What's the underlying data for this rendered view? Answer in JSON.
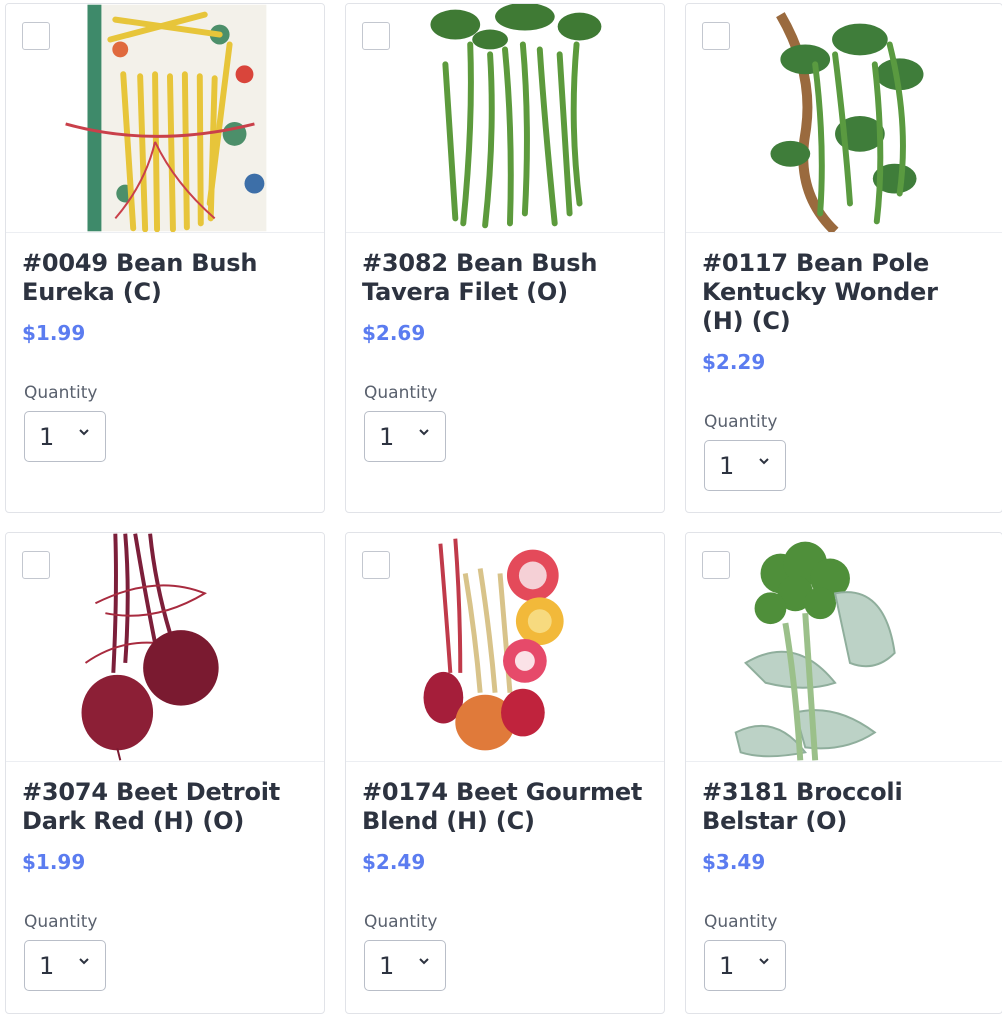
{
  "products": [
    {
      "title": "#0049 Bean Bush Eureka (C)",
      "price": "$1.99",
      "qty_label": "Quantity",
      "qty_value": "1",
      "image_icon": "yellow-bush-beans-illustration"
    },
    {
      "title": "#3082 Bean Bush Tavera Filet (O)",
      "price": "$2.69",
      "qty_label": "Quantity",
      "qty_value": "1",
      "image_icon": "green-filet-beans-illustration"
    },
    {
      "title": "#0117 Bean Pole Kentucky Wonder (H) (C)",
      "price": "$2.29",
      "qty_label": "Quantity",
      "qty_value": "1",
      "image_icon": "pole-beans-illustration"
    },
    {
      "title": "#3074 Beet Detroit Dark Red (H) (O)",
      "price": "$1.99",
      "qty_label": "Quantity",
      "qty_value": "1",
      "image_icon": "red-beets-illustration"
    },
    {
      "title": "#0174 Beet Gourmet Blend (H) (C)",
      "price": "$2.49",
      "qty_label": "Quantity",
      "qty_value": "1",
      "image_icon": "gourmet-beets-illustration"
    },
    {
      "title": "#3181 Broccoli Belstar (O)",
      "price": "$3.49",
      "qty_label": "Quantity",
      "qty_value": "1",
      "image_icon": "broccoli-illustration"
    }
  ],
  "colors": {
    "price": "#5b7cf0",
    "title": "#2d3340",
    "border": "#e1e3e8"
  }
}
